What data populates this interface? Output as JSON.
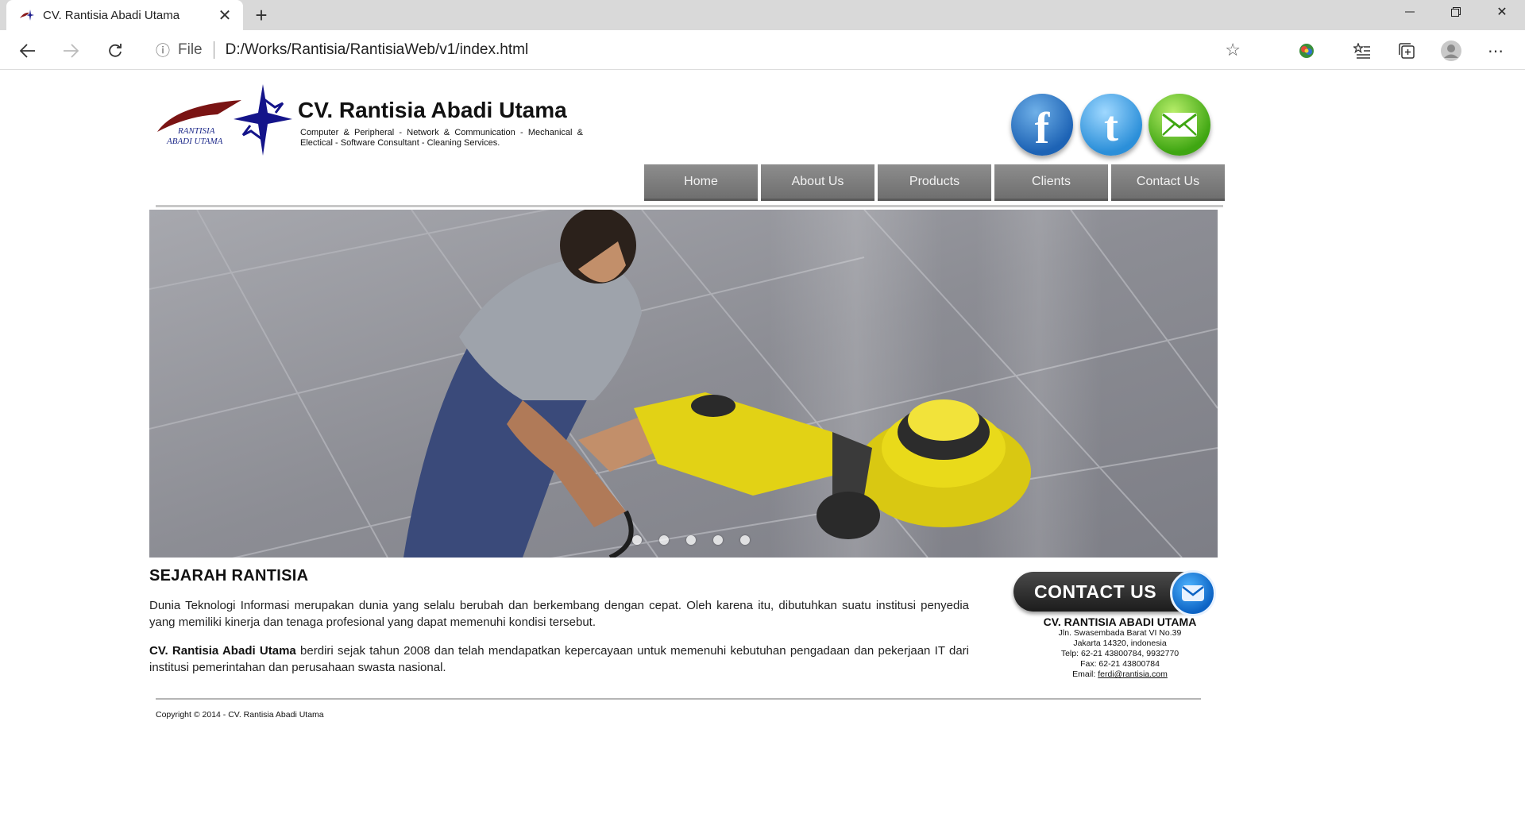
{
  "browser": {
    "tab_title": "CV. Rantisia Abadi Utama",
    "address_scheme": "File",
    "address_url": "D:/Works/Rantisia/RantisiaWeb/v1/index.html"
  },
  "site": {
    "logo_text_line1": "RANTISIA",
    "logo_text_line2": "ABADI UTAMA",
    "title": "CV. Rantisia Abadi Utama",
    "tagline": "Computer & Peripheral - Network & Communication - Mechanical & Electical - Software Consultant - Cleaning Services."
  },
  "nav": {
    "items": [
      {
        "label": "Home"
      },
      {
        "label": "About Us"
      },
      {
        "label": "Products"
      },
      {
        "label": "Clients"
      },
      {
        "label": "Contact Us"
      }
    ]
  },
  "slider": {
    "slide_count": 5
  },
  "history": {
    "title": "SEJARAH RANTISIA",
    "paragraph1": "Dunia Teknologi Informasi merupakan dunia yang selalu berubah dan berkembang dengan cepat. Oleh karena itu, dibutuhkan suatu institusi penyedia yang memiliki kinerja dan tenaga profesional yang dapat memenuhi kondisi tersebut.",
    "paragraph2_bold": "CV. Rantisia Abadi Utama",
    "paragraph2_rest": " berdiri sejak tahun 2008 dan telah mendapatkan kepercayaan untuk memenuhi kebutuhan pengadaan dan pekerjaan IT dari institusi pemerintahan dan perusahaan swasta nasional."
  },
  "contact": {
    "banner_label": "CONTACT US",
    "company": "CV. RANTISIA ABADI UTAMA",
    "address1": "Jln. Swasembada Barat VI No.39",
    "address2": "Jakarta 14320, indonesia",
    "phone": "Telp: 62-21 43800784, 9932770",
    "fax": "Fax: 62-21 43800784",
    "email_label": "Email: ",
    "email": "ferdi@rantisia.com"
  },
  "footer": {
    "copyright": "Copyright © 2014 - CV. Rantisia Abadi Utama"
  },
  "colors": {
    "nav_bg": "#7a7a7a",
    "logo_star": "#1a1a8c",
    "logo_swoosh": "#8b1a1a"
  }
}
